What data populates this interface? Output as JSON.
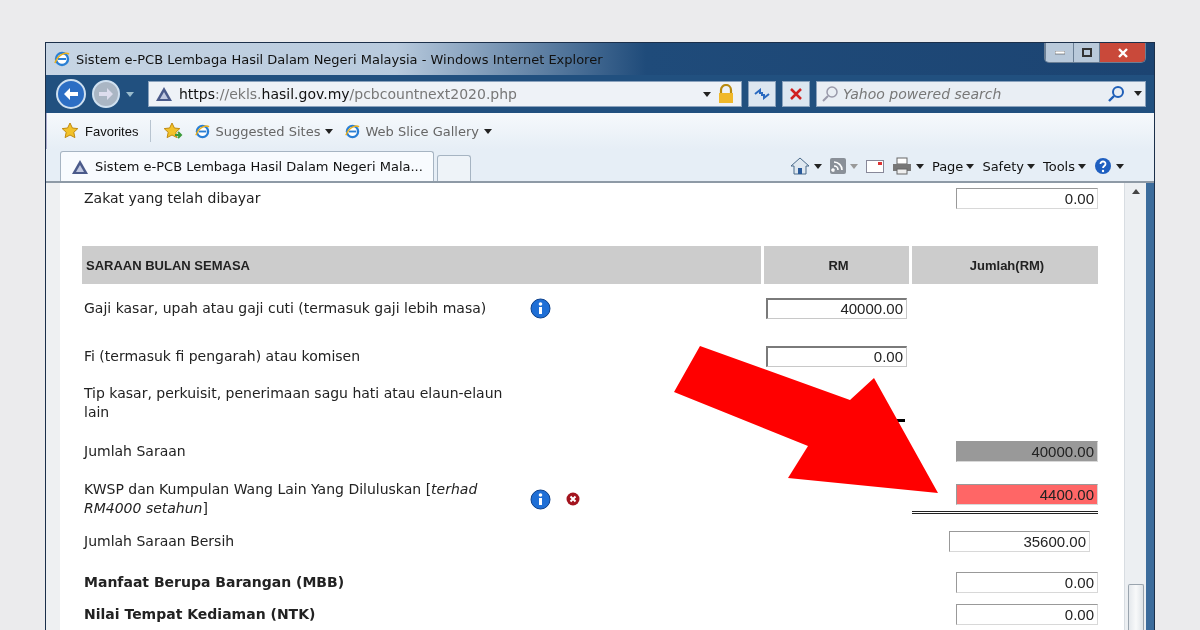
{
  "window": {
    "title": "Sistem e-PCB Lembaga Hasil Dalam Negeri Malaysia - Windows Internet Explorer"
  },
  "address_bar": {
    "url": [
      {
        "text": "https",
        "emphasized": true
      },
      {
        "text": "://ekls.",
        "emphasized": false
      },
      {
        "text": "hasil.gov.my",
        "emphasized": true
      },
      {
        "text": "/pcbcountnext2020.php",
        "emphasized": false
      }
    ]
  },
  "search": {
    "placeholder": "Yahoo powered search"
  },
  "favorites_bar": {
    "favorites": "Favorites",
    "links": [
      "Suggested Sites",
      "Web Slice Gallery"
    ]
  },
  "tabs": [
    {
      "label": "Sistem e-PCB Lembaga Hasil Dalam Negeri Mala...",
      "selected": true
    }
  ],
  "command_bar": {
    "menus": [
      "Page",
      "Safety",
      "Tools"
    ]
  },
  "form": {
    "rows": [
      {
        "kind": "total",
        "label": "Zakat yang telah dibayar",
        "value": "0.00",
        "color": "#ffffff"
      },
      {
        "kind": "header",
        "label": "SARAAN BULAN SEMASA",
        "columns": [
          "RM",
          "Jumlah(RM)"
        ]
      },
      {
        "kind": "amount",
        "label": "Gaji kasar, upah atau gaji cuti (termasuk gaji lebih masa)",
        "value": "40000.00",
        "info": true
      },
      {
        "kind": "amount",
        "label": "Fi (termasuk fi pengarah) atau komisen",
        "value": "0.00"
      },
      {
        "kind": "amount",
        "label": "Tip kasar, perkuisit, penerimaan sagu hati atau elaun-elaun lain"
      },
      {
        "kind": "total",
        "label": "Jumlah Saraan",
        "value": "40000.00",
        "color": "#999999"
      },
      {
        "kind": "total",
        "label": "KWSP dan Kumpulan Wang Lain Yang Diluluskan [*terhad RM4000 setahun*]",
        "value": "4400.00",
        "color": "#ff6666",
        "info": true,
        "clear": true
      },
      {
        "kind": "total",
        "label": "Jumlah Saraan Bersih",
        "value": "35600.00",
        "color": "#ffffff"
      },
      {
        "kind": "total",
        "label": "Manfaat Berupa Barangan (MBB)",
        "value": "0.00",
        "color": "#ffffff",
        "bold": true
      },
      {
        "kind": "total",
        "label": "Nilai Tempat Kediaman (NTK)",
        "value": "0.00",
        "color": "#ffffff",
        "bold": true
      }
    ]
  },
  "annotation": {
    "kind": "arrow"
  }
}
